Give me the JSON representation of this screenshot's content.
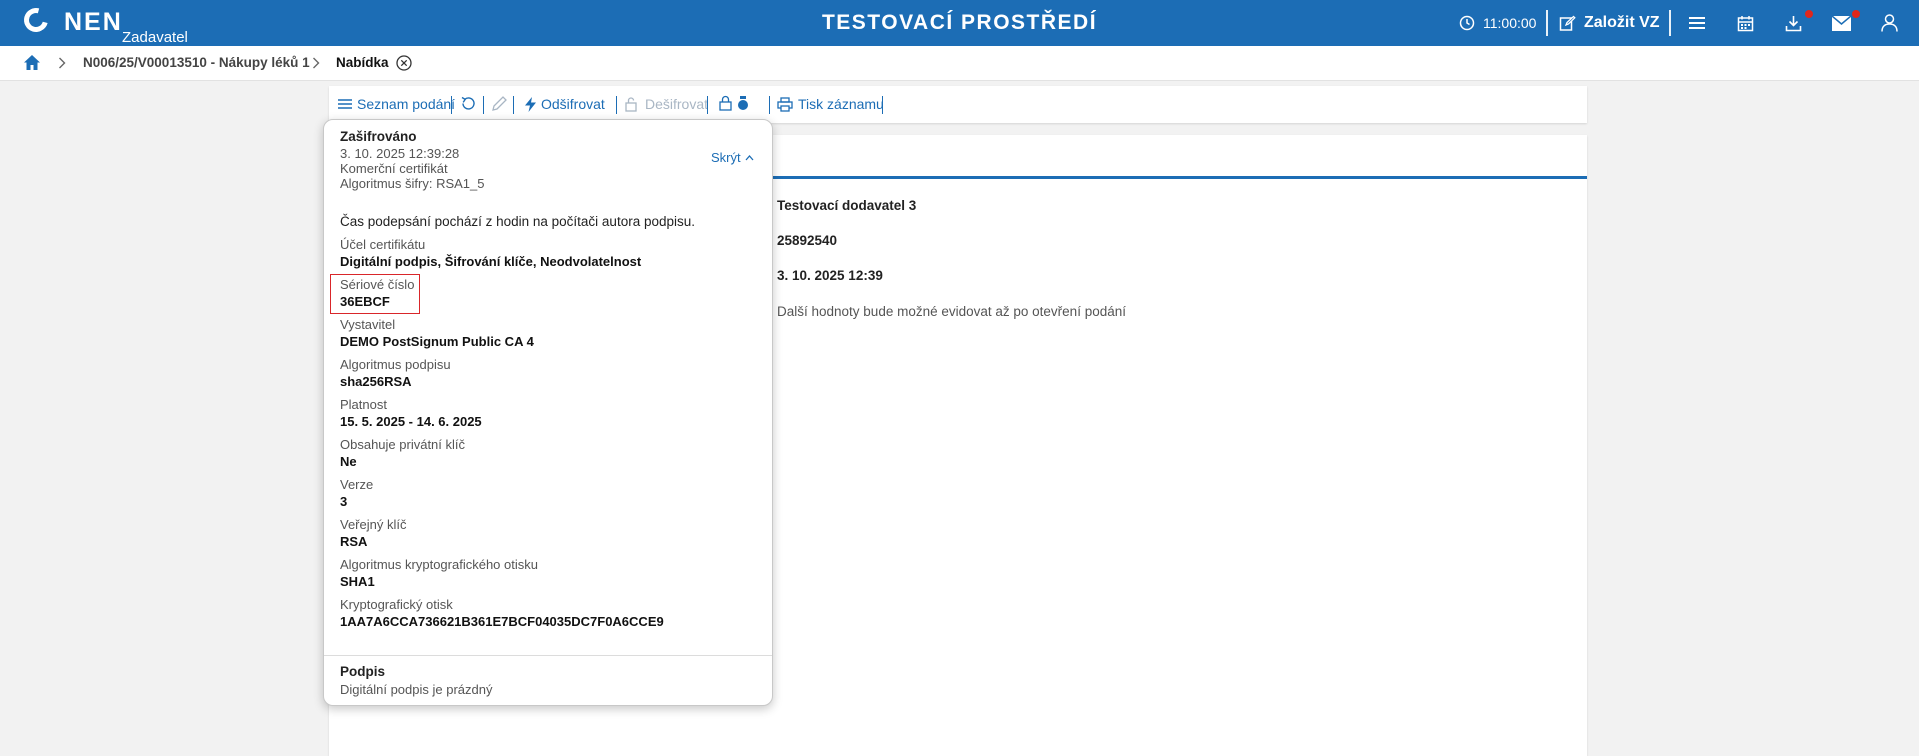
{
  "header": {
    "logo_text": "NEN",
    "logo_sub": "Zadavatel",
    "environment": "TESTOVACÍ PROSTŘEDÍ",
    "time": "11:00:00",
    "create_label": "Založit VZ",
    "bg_color": "#1c6db5",
    "icons": [
      "clock-icon",
      "edit-icon",
      "menu-icon",
      "calendar-icon",
      "download-icon",
      "mail-icon",
      "user-icon"
    ]
  },
  "breadcrumb": {
    "items": [
      "N006/25/V00013510 - Nákupy léků 1",
      "Nabídka"
    ]
  },
  "toolbar": {
    "list_label": "Seznam podání",
    "decrypt_label": "Odšifrovat",
    "encrypt_label": "Dešifrovat",
    "print_label": "Tisk záznamu"
  },
  "content": {
    "supplier": "Testovací dodavatel 3",
    "id_number": "25892540",
    "submitted": "3. 10. 2025 12:39",
    "note": "Další hodnoty bude možné evidovat až po otevření podání"
  },
  "popover": {
    "title": "Zašifrováno",
    "hide_label": "Skrýt",
    "datetime": "3. 10. 2025 12:39:28",
    "cert_type": "Komerční certifikát",
    "algorithm": "Algoritmus šifry: RSA1_5",
    "time_note": "Čas podepsání pochází z hodin na počítači autora podpisu.",
    "fields": [
      {
        "label": "Účel certifikátu",
        "value": "Digitální podpis, Šifrování klíče, Neodvolatelnost"
      },
      {
        "label": "Sériové číslo",
        "value": "36EBCF"
      },
      {
        "label": "Vystavitel",
        "value": "DEMO PostSignum Public CA 4"
      },
      {
        "label": "Algoritmus podpisu",
        "value": "sha256RSA"
      },
      {
        "label": "Platnost",
        "value": "15. 5. 2025 - 14. 6. 2025"
      },
      {
        "label": "Obsahuje privátní klíč",
        "value": "Ne"
      },
      {
        "label": "Verze",
        "value": "3"
      },
      {
        "label": "Veřejný klíč",
        "value": "RSA"
      },
      {
        "label": "Algoritmus kryptografického otisku",
        "value": "SHA1"
      },
      {
        "label": "Kryptografický otisk",
        "value": "1AA7A6CCA736621B361E7BCF04035DC7F0A6CCE9"
      }
    ],
    "signature_title": "Podpis",
    "signature_text": "Digitální podpis je prázdný"
  }
}
